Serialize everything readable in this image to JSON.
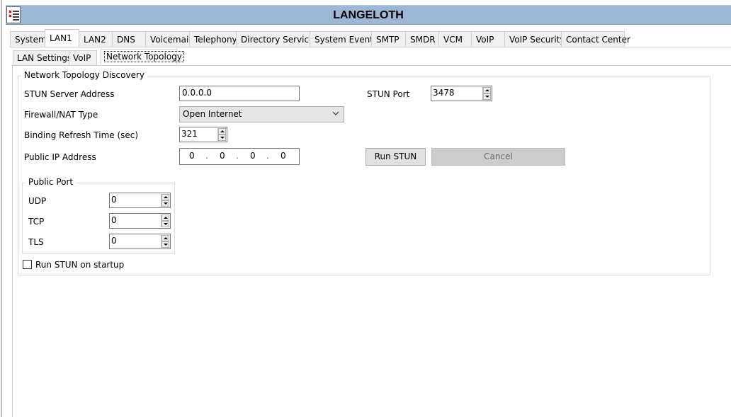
{
  "window": {
    "title": "LANGELOTH"
  },
  "main_tabs": [
    "System",
    "LAN1",
    "LAN2",
    "DNS",
    "Voicemail",
    "Telephony",
    "Directory Services",
    "System Events",
    "SMTP",
    "SMDR",
    "VCM",
    "VoIP",
    "VoIP Security",
    "Contact Center"
  ],
  "active_main_tab": "LAN1",
  "sub_tabs": [
    "LAN Settings",
    "VoIP",
    "Network Topology"
  ],
  "active_sub_tab": "Network Topology",
  "group": {
    "legend": "Network Topology Discovery",
    "stun_server_label": "STUN Server Address",
    "stun_server_value": "0.0.0.0",
    "stun_port_label": "STUN Port",
    "stun_port_value": "3478",
    "firewall_label": "Firewall/NAT Type",
    "firewall_value": "Open Internet",
    "binding_label": "Binding Refresh Time (sec)",
    "binding_value": "321",
    "public_ip_label": "Public IP Address",
    "public_ip_octets": [
      "0",
      "0",
      "0",
      "0"
    ],
    "run_stun_label": "Run STUN",
    "cancel_label": "Cancel"
  },
  "public_port": {
    "legend": "Public Port",
    "udp_label": "UDP",
    "udp_value": "0",
    "tcp_label": "TCP",
    "tcp_value": "0",
    "tls_label": "TLS",
    "tls_value": "0"
  },
  "run_on_startup": {
    "label": "Run STUN on startup",
    "checked": false
  }
}
